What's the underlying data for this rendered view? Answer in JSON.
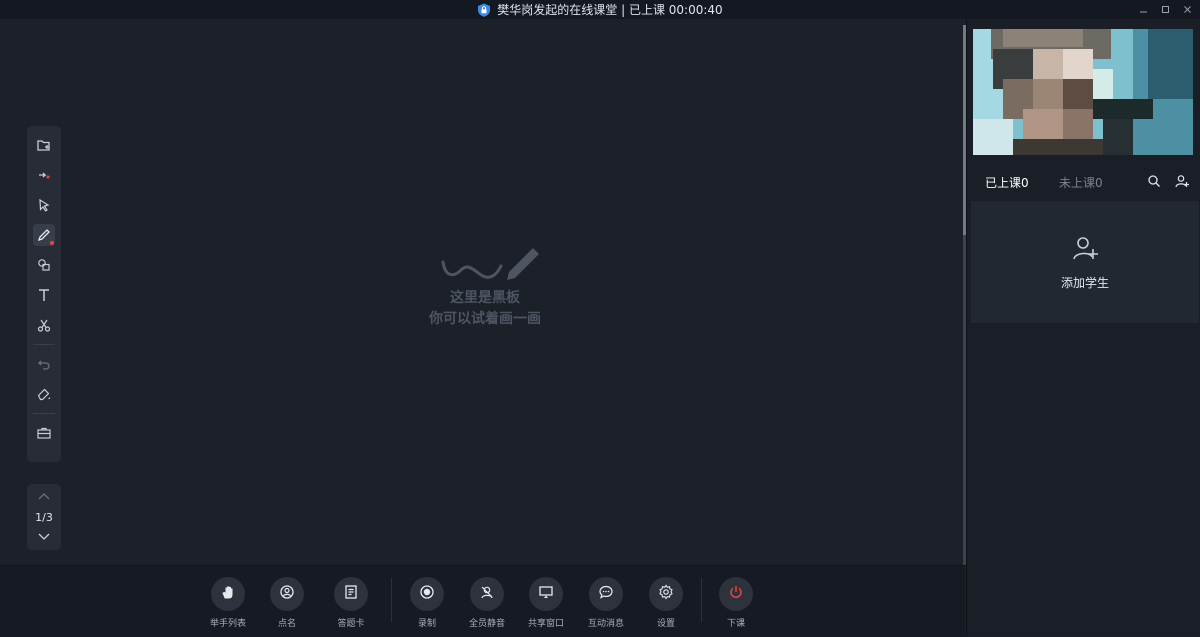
{
  "window": {
    "title": "樊华岗发起的在线课堂 | 已上课 00:00:40"
  },
  "toolbar": {
    "tools": [
      "import-file",
      "laser-pointer",
      "select",
      "pen",
      "shapes",
      "text",
      "cut",
      "undo",
      "eraser",
      "toolbox"
    ],
    "active_tool": "pen"
  },
  "pager": {
    "label": "1/3"
  },
  "board": {
    "empty_line1": "这里是黑板",
    "empty_line2": "你可以试着画一画"
  },
  "controls": [
    {
      "label": "举手列表",
      "icon": "hand-icon"
    },
    {
      "label": "点名",
      "icon": "rollcall-icon"
    },
    {
      "label": "答题卡",
      "icon": "answer-card-icon"
    },
    {
      "label": "录制",
      "icon": "record-icon"
    },
    {
      "label": "全员静音",
      "icon": "mute-all-icon"
    },
    {
      "label": "共享窗口",
      "icon": "share-screen-icon"
    },
    {
      "label": "互动消息",
      "icon": "chat-icon"
    },
    {
      "label": "设置",
      "icon": "settings-icon"
    },
    {
      "label": "下课",
      "icon": "power-icon"
    }
  ],
  "students": {
    "tab_in": "已上课0",
    "tab_out": "未上课0",
    "add_label": "添加学生"
  },
  "colors": {
    "background": "#1c2029",
    "panel": "#1a1e26",
    "end_class": "#e0453d"
  }
}
